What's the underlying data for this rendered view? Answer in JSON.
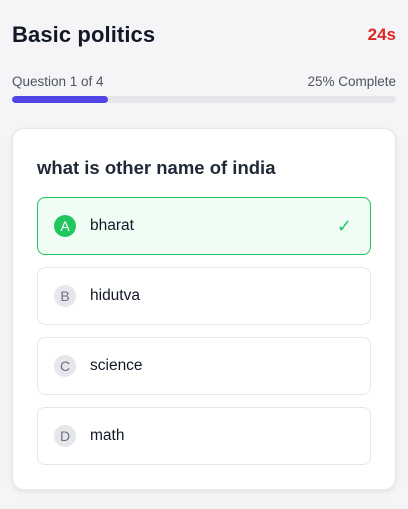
{
  "quiz": {
    "title": "Basic politics",
    "timer": "24s"
  },
  "progress": {
    "question_label": "Question 1 of 4",
    "complete_label": "25% Complete",
    "fraction": 0.25,
    "color": "#4f46e5"
  },
  "question": {
    "text": "what is other name of india",
    "options": [
      {
        "letter": "A",
        "text": "bharat",
        "selected": true
      },
      {
        "letter": "B",
        "text": "hidutva",
        "selected": false
      },
      {
        "letter": "C",
        "text": "science",
        "selected": false
      },
      {
        "letter": "D",
        "text": "math",
        "selected": false
      }
    ],
    "check_icon": "✓"
  },
  "colors": {
    "timer": "#dc2626",
    "correct": "#22c55e"
  }
}
